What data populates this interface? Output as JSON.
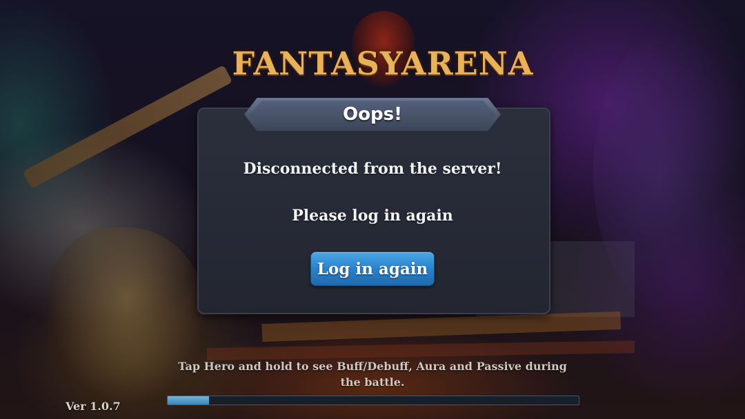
{
  "logo": {
    "text": "FANTASYARENA"
  },
  "dialog": {
    "title": "Oops!",
    "message_line1": "Disconnected from the server!",
    "message_line2": "Please log in again",
    "button_label": "Log in again"
  },
  "loading": {
    "tip": "Tap Hero and hold to see Buff/Debuff, Aura and Passive during the battle.",
    "progress": 0.1
  },
  "version": "Ver 1.0.7",
  "colors": {
    "button": "#2a82cc",
    "dialog_bg": "#232631",
    "logo": "#e8b25a"
  }
}
